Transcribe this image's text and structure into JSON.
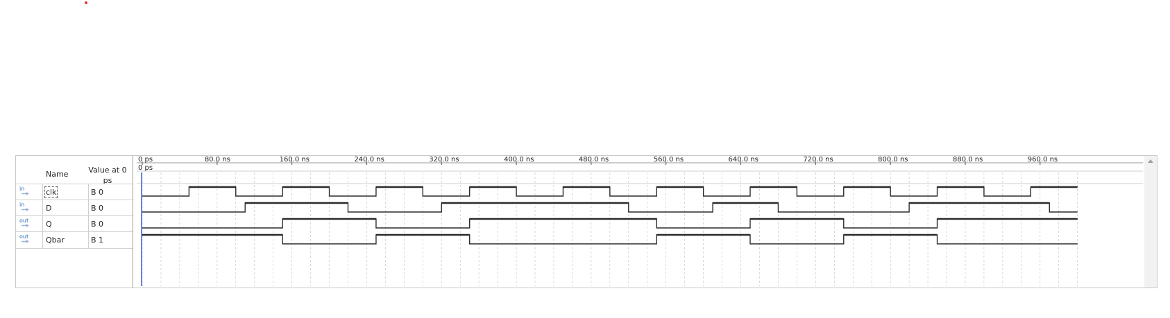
{
  "header": {
    "name_label": "Name",
    "value_label": "Value at 0 ps"
  },
  "cursor_label": "0 ps",
  "time_axis": {
    "unit": "ns",
    "labels": [
      "0 ps",
      "80.0 ns",
      "160.0 ns",
      "240.0 ns",
      "320.0 ns",
      "400.0 ns",
      "480.0 ns",
      "560.0 ns",
      "640.0 ns",
      "720.0 ns",
      "800.0 ns",
      "880.0 ns",
      "960.0 ns"
    ],
    "range_ns": [
      0,
      1000
    ]
  },
  "signals": [
    {
      "io": "in",
      "name": "clk",
      "value": "B 0",
      "transitions_ns": [
        [
          0,
          0
        ],
        [
          50,
          1
        ],
        [
          100,
          0
        ],
        [
          150,
          1
        ],
        [
          200,
          0
        ],
        [
          250,
          1
        ],
        [
          300,
          0
        ],
        [
          350,
          1
        ],
        [
          400,
          0
        ],
        [
          450,
          1
        ],
        [
          500,
          0
        ],
        [
          550,
          1
        ],
        [
          600,
          0
        ],
        [
          650,
          1
        ],
        [
          700,
          0
        ],
        [
          750,
          1
        ],
        [
          800,
          0
        ],
        [
          850,
          1
        ],
        [
          900,
          0
        ],
        [
          950,
          1
        ]
      ]
    },
    {
      "io": "in",
      "name": "D",
      "value": "B 0",
      "transitions_ns": [
        [
          0,
          0
        ],
        [
          110,
          1
        ],
        [
          220,
          0
        ],
        [
          320,
          1
        ],
        [
          520,
          0
        ],
        [
          610,
          1
        ],
        [
          680,
          0
        ],
        [
          820,
          1
        ],
        [
          970,
          0
        ]
      ]
    },
    {
      "io": "out",
      "name": "Q",
      "value": "B 0",
      "transitions_ns": [
        [
          0,
          0
        ],
        [
          150,
          1
        ],
        [
          250,
          0
        ],
        [
          350,
          1
        ],
        [
          550,
          0
        ],
        [
          650,
          1
        ],
        [
          750,
          0
        ],
        [
          850,
          1
        ]
      ]
    },
    {
      "io": "out",
      "name": "Qbar",
      "value": "B 1",
      "transitions_ns": [
        [
          0,
          1
        ],
        [
          150,
          0
        ],
        [
          250,
          1
        ],
        [
          350,
          0
        ],
        [
          550,
          1
        ],
        [
          650,
          0
        ],
        [
          750,
          1
        ],
        [
          850,
          0
        ]
      ]
    }
  ],
  "colors": {
    "wave": "#2b2b2b",
    "grid": "#bdbdbd",
    "cursor": "#3a5fcd"
  }
}
